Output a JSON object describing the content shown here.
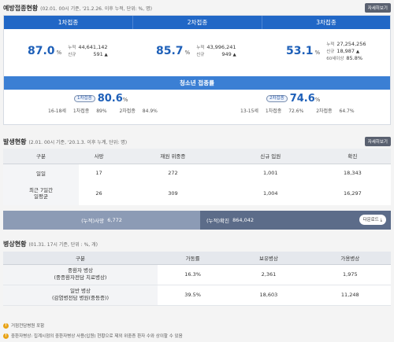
{
  "vaccination": {
    "title": "예방접종현황",
    "subtitle": "(02.01. 00시 기준, '21.2.26. 이후 누적, 단위: %, 명)",
    "detail_label": "자세히보기",
    "doses": [
      {
        "label": "1차접종",
        "percent": "87.0",
        "unit": "%",
        "cum_label": "누적",
        "cum": "44,641,142",
        "new_label": "신규",
        "new": "591",
        "extra_label": "",
        "extra": ""
      },
      {
        "label": "2차접종",
        "percent": "85.7",
        "unit": "%",
        "cum_label": "누적",
        "cum": "43,996,241",
        "new_label": "신규",
        "new": "949",
        "extra_label": "",
        "extra": ""
      },
      {
        "label": "3차접종",
        "percent": "53.1",
        "unit": "%",
        "cum_label": "누적",
        "cum": "27,254,256",
        "new_label": "신규",
        "new": "18,987",
        "extra_label": "60세이상",
        "extra": "85.8%"
      }
    ],
    "teen_title": "청소년 접종률",
    "teen": [
      {
        "tag": "1차접종",
        "percent": "80.6",
        "unit": "%",
        "age": "16-18세",
        "d1_label": "1차접종",
        "d1": "89%",
        "d2_label": "2차접종",
        "d2": "84.9%"
      },
      {
        "tag": "2차접종",
        "percent": "74.6",
        "unit": "%",
        "age": "13-15세",
        "d1_label": "1차접종",
        "d1": "72.6%",
        "d2_label": "2차접종",
        "d2": "64.7%"
      }
    ]
  },
  "outbreak": {
    "title": "발생현황",
    "subtitle": "(2.01. 00시 기준, '20.1.3. 이후 누계, 단위: 명)",
    "detail_label": "자세히보기",
    "columns": [
      "구분",
      "사망",
      "재원 위중증",
      "신규 입원",
      "확진"
    ],
    "rows": [
      {
        "label": "일일",
        "values": [
          "17",
          "272",
          "1,001",
          "18,343"
        ]
      },
      {
        "label": "최근 7일간\n일평균",
        "values": [
          "26",
          "309",
          "1,004",
          "16,297"
        ]
      }
    ],
    "cum_death_label": "(누적)사망",
    "cum_death": "6,772",
    "cum_confirmed_label": "(누적)확진",
    "cum_confirmed": "864,042",
    "download_label": "다운로드"
  },
  "beds": {
    "title": "병상현황",
    "subtitle": "(01.31. 17시 기준, 단위 : %, 개)",
    "columns": [
      "구분",
      "가동률",
      "보유병상",
      "가용병상"
    ],
    "rows": [
      {
        "label": "중환자 병상\n(중증환자전담 치료병상)",
        "values": [
          "16.3%",
          "2,361",
          "1,975"
        ]
      },
      {
        "label": "일반 병상\n(감염병전담 병원(중등증))",
        "values": [
          "39.5%",
          "18,603",
          "11,248"
        ]
      }
    ],
    "notes": [
      "거점전담병원 포함",
      "중환자병상: 집계시점의 중환자병상 사용(입원) 현황으로 제외 위중증 환자 수와 상이할 수 있음"
    ]
  },
  "colors": {
    "primary": "#2167c6",
    "teen_bar": "#3b7fd4",
    "cum_dark": "#5c6c89",
    "cum_light": "#8c9bb5"
  }
}
